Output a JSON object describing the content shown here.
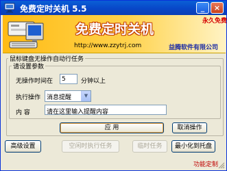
{
  "window": {
    "title": "免费定时关机 5.5",
    "minimize_glyph": "_",
    "close_glyph": "×"
  },
  "banner": {
    "badge": "永久免费",
    "title": "免费定时关机",
    "url": "http://www.zzytrj.com",
    "company": "益腾软件有限公司"
  },
  "task_group": {
    "legend": "鼠标键盘无操作自动行任务"
  },
  "params_group": {
    "legend": "请设置参数",
    "idle_label": "无操作时间在",
    "idle_value": "5",
    "idle_unit": "分钟以上",
    "action_label": "执行操作",
    "action_value": "消息提醒",
    "content_label": "内   容",
    "content_value": "请在这里输入提醒内容"
  },
  "buttons": {
    "apply": "应  用",
    "cancel": "取消操作",
    "advanced": "高级设置",
    "idle_task": "空闲时执行任务",
    "temp_task": "临时任务",
    "minimize_tray": "最小化到托盘"
  },
  "footer": {
    "feature_custom": "功能定制"
  }
}
